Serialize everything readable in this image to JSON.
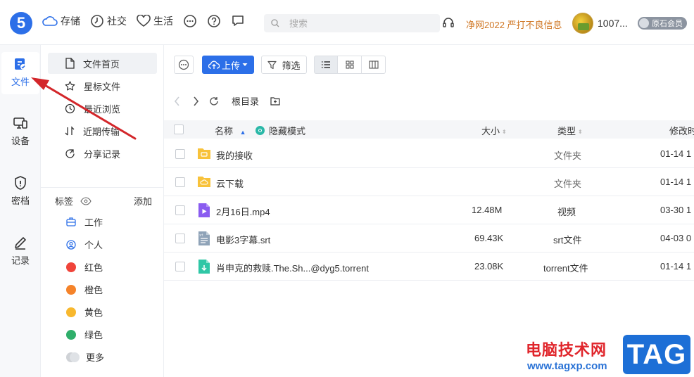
{
  "colors": {
    "accent": "#2c6fe8",
    "notice": "#d07826",
    "arrow": "#d3262a",
    "folder": "#f8c23a"
  },
  "topbar": {
    "logo": "5",
    "nav": [
      {
        "label": "存储",
        "icon": "cloud-icon"
      },
      {
        "label": "社交",
        "icon": "clock-icon"
      },
      {
        "label": "生活",
        "icon": "heart-icon"
      }
    ],
    "search_placeholder": "搜索",
    "notice": "净网2022 严打不良信息",
    "username": "1007...",
    "vip_label": "原石会员"
  },
  "rail": [
    {
      "label": "文件",
      "icon": "file-icon",
      "active": true
    },
    {
      "label": "设备",
      "icon": "device-icon",
      "active": false
    },
    {
      "label": "密档",
      "icon": "shield-icon",
      "active": false
    },
    {
      "label": "记录",
      "icon": "pencil-icon",
      "active": false
    }
  ],
  "side": {
    "items": [
      {
        "label": "文件首页",
        "icon": "document-icon",
        "active": true
      },
      {
        "label": "星标文件",
        "icon": "star-icon",
        "active": false
      },
      {
        "label": "最近浏览",
        "icon": "history-icon",
        "active": false
      },
      {
        "label": "近期传输",
        "icon": "transfer-icon",
        "active": false
      },
      {
        "label": "分享记录",
        "icon": "share-icon",
        "active": false
      }
    ],
    "tags_title": "标签",
    "tags_add": "添加",
    "tags": [
      {
        "label": "工作",
        "icon": "briefcase-icon",
        "color": ""
      },
      {
        "label": "个人",
        "icon": "person-icon",
        "color": ""
      },
      {
        "label": "红色",
        "icon": "",
        "color": "#f0443a"
      },
      {
        "label": "橙色",
        "icon": "",
        "color": "#f5832a"
      },
      {
        "label": "黄色",
        "icon": "",
        "color": "#f8b82e"
      },
      {
        "label": "绿色",
        "icon": "",
        "color": "#2fae6a"
      },
      {
        "label": "更多",
        "icon": "",
        "color": "#cfd2d6"
      }
    ]
  },
  "toolbar": {
    "upload_label": "上传",
    "filter_label": "筛选"
  },
  "path": {
    "root": "根目录"
  },
  "table": {
    "headers": {
      "name": "名称",
      "hidden_mode": "隐藏模式",
      "size": "大小",
      "type": "类型",
      "modified": "修改时"
    },
    "rows": [
      {
        "name": "我的接收",
        "size": "",
        "type": "文件夹",
        "date": "01-14 1",
        "icon": "folder-receive-icon"
      },
      {
        "name": "云下载",
        "size": "",
        "type": "文件夹",
        "date": "01-14 1",
        "icon": "folder-cloud-icon"
      },
      {
        "name": "2月16日.mp4",
        "size": "12.48M",
        "type": "视频",
        "date": "03-30 1",
        "icon": "video-file-icon"
      },
      {
        "name": "电影3字幕.srt",
        "size": "69.43K",
        "type": "srt文件",
        "date": "04-03 0",
        "icon": "srt-file-icon"
      },
      {
        "name": "肖申克的救赎.The.Sh...@dyg5.torrent",
        "size": "23.08K",
        "type": "torrent文件",
        "date": "01-14 1",
        "icon": "torrent-file-icon"
      }
    ]
  },
  "watermark": {
    "cn": "电脑技术网",
    "url": "www.tagxp.com",
    "tag": "TAG"
  }
}
